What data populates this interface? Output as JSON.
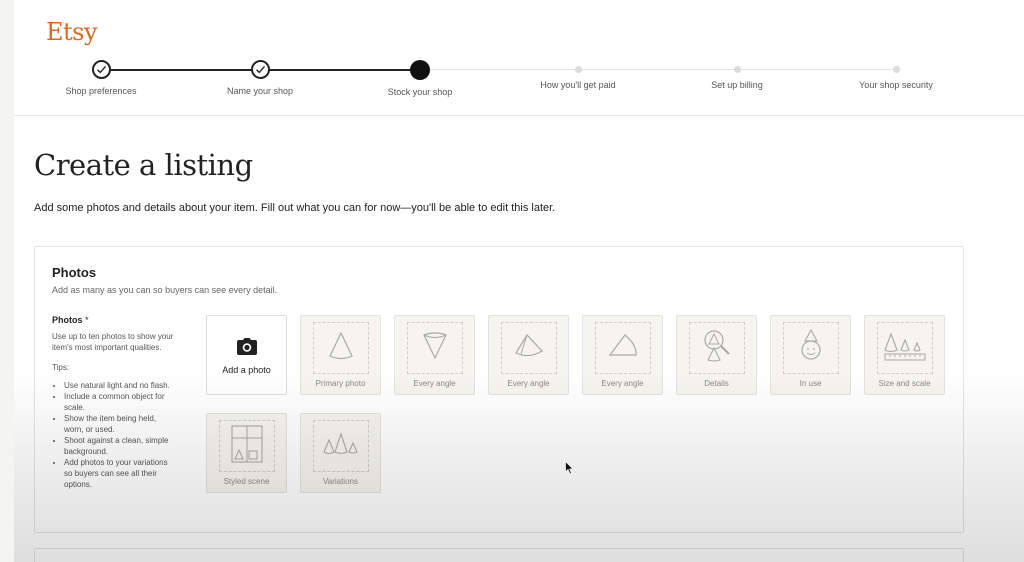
{
  "header": {
    "logo": "Etsy",
    "steps": [
      {
        "label": "Shop preferences",
        "state": "done"
      },
      {
        "label": "Name your shop",
        "state": "done"
      },
      {
        "label": "Stock your shop",
        "state": "current"
      },
      {
        "label": "How you'll get paid",
        "state": "todo"
      },
      {
        "label": "Set up billing",
        "state": "todo"
      },
      {
        "label": "Your shop security",
        "state": "todo"
      }
    ]
  },
  "main": {
    "title": "Create a listing",
    "subtitle": "Add some photos and details about your item. Fill out what you can for now—you'll be able to edit this later."
  },
  "photos": {
    "title": "Photos",
    "subtitle": "Add as many as you can so buyers can see every detail.",
    "side_title": "Photos",
    "required_mark": "*",
    "side_desc": "Use up to ten photos to show your item's most important qualities.",
    "tips_label": "Tips:",
    "tips": [
      "Use natural light and no flash.",
      "Include a common object for scale.",
      "Show the item being held, worn, or used.",
      "Shoot against a clean, simple background.",
      "Add photos to your variations so buyers can see all their options."
    ],
    "add_photo_label": "Add a photo",
    "add_photo_icon": "camera-icon",
    "slots": [
      {
        "label": "Primary photo",
        "icon": "cone-icon"
      },
      {
        "label": "Every angle",
        "icon": "cone-inverted-icon"
      },
      {
        "label": "Every angle",
        "icon": "cone-tilted-icon"
      },
      {
        "label": "Every angle",
        "icon": "cone-side-icon"
      },
      {
        "label": "Details",
        "icon": "magnifier-cone-icon"
      },
      {
        "label": "In use",
        "icon": "cone-face-icon"
      },
      {
        "label": "Size and scale",
        "icon": "cones-ruler-icon"
      },
      {
        "label": "Styled scene",
        "icon": "window-scene-icon"
      },
      {
        "label": "Variations",
        "icon": "cone-variations-icon"
      }
    ]
  },
  "colors": {
    "brand": "#e0661d",
    "text": "#222222",
    "tile_bg": "#f5f4ef"
  }
}
